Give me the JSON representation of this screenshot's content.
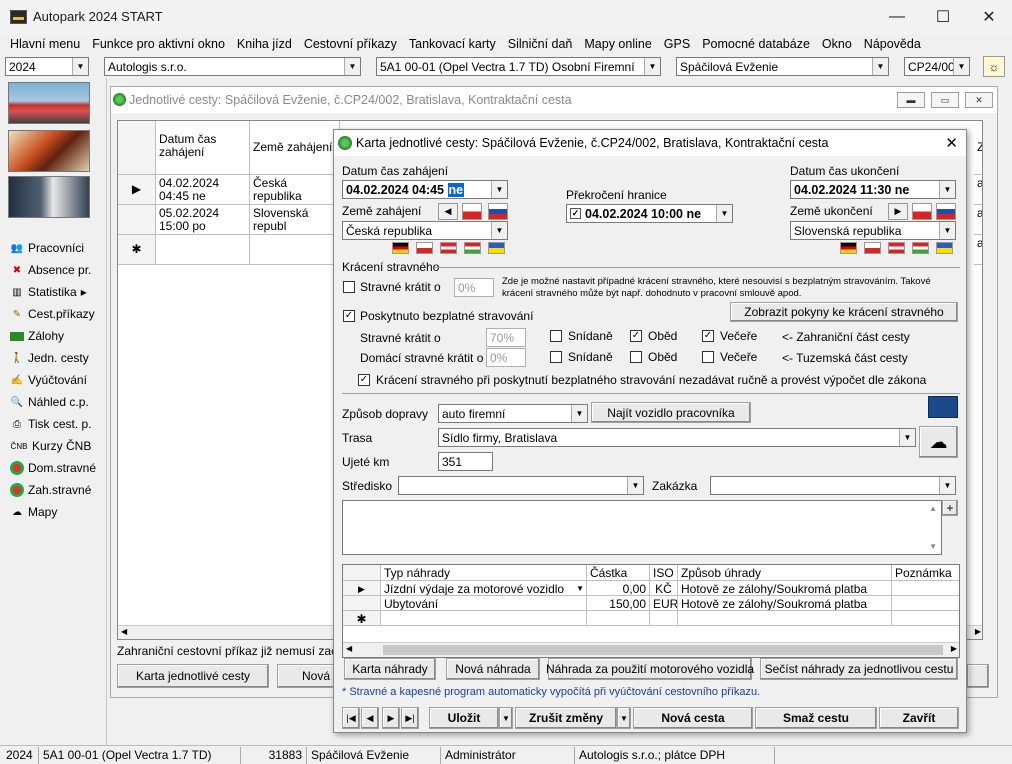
{
  "window": {
    "title": "Autopark 2024 START",
    "minimize": "—",
    "maximize": "☐",
    "close": "✕"
  },
  "menu": [
    "Hlavní menu",
    "Funkce pro aktivní okno",
    "Kniha jízd",
    "Cestovní příkazy",
    "Tankovací karty",
    "Silniční daň",
    "Mapy online",
    "GPS",
    "Pomocné databáze",
    "Okno",
    "Nápověda"
  ],
  "selectors": {
    "year": "2024",
    "company": "Autologis s.r.o.",
    "vehicle": "5A1 00-01 (Opel Vectra 1.7 TD) Osobní Firemní",
    "driver": "Spáčilová Evženie",
    "order": "CP24/00"
  },
  "sidebar": [
    "Pracovníci",
    "Absence pr.",
    "Statistika",
    "Cest.příkazy",
    "Zálohy",
    "Jedn. cesty",
    "Vyúčtování",
    "Náhled c.p.",
    "Tisk cest. p.",
    "Kurzy ČNB",
    "Dom.stravné",
    "Zah.stravné",
    "Mapy"
  ],
  "sidebar_icons": [
    "people-icon",
    "absence-icon",
    "statistics-icon",
    "travel-order-icon",
    "cash-icon",
    "trips-icon",
    "settlement-icon",
    "preview-icon",
    "print-icon",
    "cnb-icon",
    "domestic-meal-icon",
    "foreign-meal-icon",
    "maps-icon"
  ],
  "statistika_arrow": "▸",
  "cnb_badge": "ČNB",
  "mdi": {
    "title": "Jednotlivé cesty: Spáčilová Evženie, č.CP24/002, Bratislava, Kontraktační cesta",
    "col_datum": "Datum čas zahájení",
    "col_zeme": "Země zahájení",
    "col_zp": "Zp",
    "rows": [
      {
        "marker": "▶",
        "datum": "04.02.2024 04:45 ne",
        "zeme": "Česká republika",
        "zp": "aut"
      },
      {
        "marker": "",
        "datum": "05.02.2024 15:00 po",
        "zeme": "Slovenská republ",
        "zp": "aut"
      },
      {
        "marker": "✱",
        "datum": "",
        "zeme": "",
        "zp": "aut"
      }
    ],
    "info": "Zahraniční cestovní příkaz již nemusí začínat",
    "btn_karta": "Karta jednotlivé cesty",
    "btn_nova": "Nová j"
  },
  "dialog": {
    "title": "Karta jednotlivé cesty: Spáčilová Evženie, č.CP24/002, Bratislava, Kontraktační cesta",
    "datum_zahajeni_label": "Datum čas zahájení",
    "datum_zahajeni": "04.02.2024 04:45",
    "datum_zahajeni_day": "ne",
    "prekroceni_label": "Překročení hranice",
    "prekroceni": "04.02.2024 10:00 ne",
    "datum_ukonceni_label": "Datum čas ukončení",
    "datum_ukonceni": "04.02.2024 11:30 ne",
    "zeme_zahajeni_label": "Země zahájení",
    "zeme_zahajeni": "Česká republika",
    "zeme_ukonceni_label": "Země ukončení",
    "zeme_ukonceni": "Slovenská republika",
    "kraceni_section": "Krácení stravného",
    "stravne_kratit_label": "Stravné krátit o",
    "stravne_kratit_value": "0%",
    "kraceni_note_1": "Zde je možné nastavit případné krácení stravného, které nesouvisí s bezplatným stravováním. Takové",
    "kraceni_note_2": "krácení stravného může být např. dohodnuto v pracovní smlouvě apod.",
    "poskytnuto_label": "Poskytnuto bezplatné stravování",
    "zobrazit_btn": "Zobrazit pokyny ke krácení stravného",
    "stravne_kratit2_label": "Stravné krátit o",
    "stravne_kratit2_value": "70%",
    "domaci_label": "Domácí stravné krátit o",
    "domaci_value": "0%",
    "snidane": "Snídaně",
    "obed": "Oběd",
    "vecere": "Večeře",
    "zahranicni_cast": "<- Zahraniční část cesty",
    "tuzemska_cast": "<- Tuzemská část cesty",
    "auto_kraceni_label": "Krácení stravného při poskytnutí bezplatného stravování nezadávat ručně a provést výpočet dle zákona",
    "zpusob_label": "Způsob dopravy",
    "zpusob_value": "auto firemní",
    "najit_btn": "Najít vozidlo pracovníka",
    "trasa_label": "Trasa",
    "trasa_value": "Sídlo firmy, Bratislava",
    "ujete_label": "Ujeté km",
    "ujete_value": "351",
    "stredisko_label": "Středisko",
    "zakazka_label": "Zakázka",
    "plus": "+",
    "table_headers": [
      "Typ náhrady",
      "Částka",
      "ISO",
      "Způsob úhrady",
      "Poznámka"
    ],
    "table_rows": [
      {
        "marker": "▶",
        "typ": "Jízdní výdaje za motorové vozidlo",
        "castka": "0,00",
        "iso": "KČ",
        "zpusob": "Hotově ze zálohy/Soukromá platba",
        "poznamka": ""
      },
      {
        "marker": "",
        "typ": "Ubytování",
        "castka": "150,00",
        "iso": "EUR",
        "zpusob": "Hotově ze zálohy/Soukromá platba",
        "poznamka": ""
      },
      {
        "marker": "✱",
        "typ": "",
        "castka": "",
        "iso": "",
        "zpusob": "",
        "poznamka": ""
      }
    ],
    "btn_karta_nahrady": "Karta náhrady",
    "btn_nova_nahrada": "Nová náhrada",
    "btn_nahrada_vozidla": "Náhrada za použití motorového vozidla",
    "btn_secist": "Sečíst náhrady za jednotlivou cestu",
    "footnote": "* Stravné a kapesné program automaticky vypočítá při vyúčtování cestovního příkazu.",
    "nav_first": "|◀",
    "nav_prev": "◀",
    "nav_next": "▶",
    "nav_last": "▶|",
    "btn_ulozit": "Uložit",
    "btn_zrusit": "Zrušit změny",
    "btn_nova_cesta": "Nová cesta",
    "btn_smaz": "Smaž cestu",
    "btn_zavrit": "Zavřít",
    "close": "✕"
  },
  "statusbar": {
    "year": "2024",
    "vehicle": "5A1 00-01 (Opel Vectra 1.7 TD)",
    "km": "31883",
    "driver": "Spáčilová Evženie",
    "user": "Administrátor",
    "company": "Autologis s.r.o.; plátce DPH"
  }
}
